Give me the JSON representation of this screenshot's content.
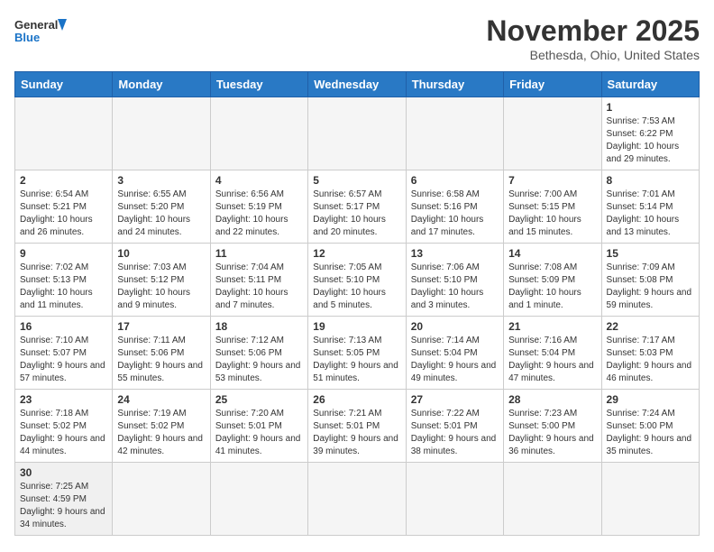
{
  "header": {
    "logo_general": "General",
    "logo_blue": "Blue",
    "month_title": "November 2025",
    "location": "Bethesda, Ohio, United States"
  },
  "weekdays": [
    "Sunday",
    "Monday",
    "Tuesday",
    "Wednesday",
    "Thursday",
    "Friday",
    "Saturday"
  ],
  "weeks": [
    [
      {
        "day": "",
        "info": ""
      },
      {
        "day": "",
        "info": ""
      },
      {
        "day": "",
        "info": ""
      },
      {
        "day": "",
        "info": ""
      },
      {
        "day": "",
        "info": ""
      },
      {
        "day": "",
        "info": ""
      },
      {
        "day": "1",
        "info": "Sunrise: 7:53 AM\nSunset: 6:22 PM\nDaylight: 10 hours and 29 minutes."
      }
    ],
    [
      {
        "day": "2",
        "info": "Sunrise: 6:54 AM\nSunset: 5:21 PM\nDaylight: 10 hours and 26 minutes."
      },
      {
        "day": "3",
        "info": "Sunrise: 6:55 AM\nSunset: 5:20 PM\nDaylight: 10 hours and 24 minutes."
      },
      {
        "day": "4",
        "info": "Sunrise: 6:56 AM\nSunset: 5:19 PM\nDaylight: 10 hours and 22 minutes."
      },
      {
        "day": "5",
        "info": "Sunrise: 6:57 AM\nSunset: 5:17 PM\nDaylight: 10 hours and 20 minutes."
      },
      {
        "day": "6",
        "info": "Sunrise: 6:58 AM\nSunset: 5:16 PM\nDaylight: 10 hours and 17 minutes."
      },
      {
        "day": "7",
        "info": "Sunrise: 7:00 AM\nSunset: 5:15 PM\nDaylight: 10 hours and 15 minutes."
      },
      {
        "day": "8",
        "info": "Sunrise: 7:01 AM\nSunset: 5:14 PM\nDaylight: 10 hours and 13 minutes."
      }
    ],
    [
      {
        "day": "9",
        "info": "Sunrise: 7:02 AM\nSunset: 5:13 PM\nDaylight: 10 hours and 11 minutes."
      },
      {
        "day": "10",
        "info": "Sunrise: 7:03 AM\nSunset: 5:12 PM\nDaylight: 10 hours and 9 minutes."
      },
      {
        "day": "11",
        "info": "Sunrise: 7:04 AM\nSunset: 5:11 PM\nDaylight: 10 hours and 7 minutes."
      },
      {
        "day": "12",
        "info": "Sunrise: 7:05 AM\nSunset: 5:10 PM\nDaylight: 10 hours and 5 minutes."
      },
      {
        "day": "13",
        "info": "Sunrise: 7:06 AM\nSunset: 5:10 PM\nDaylight: 10 hours and 3 minutes."
      },
      {
        "day": "14",
        "info": "Sunrise: 7:08 AM\nSunset: 5:09 PM\nDaylight: 10 hours and 1 minute."
      },
      {
        "day": "15",
        "info": "Sunrise: 7:09 AM\nSunset: 5:08 PM\nDaylight: 9 hours and 59 minutes."
      }
    ],
    [
      {
        "day": "16",
        "info": "Sunrise: 7:10 AM\nSunset: 5:07 PM\nDaylight: 9 hours and 57 minutes."
      },
      {
        "day": "17",
        "info": "Sunrise: 7:11 AM\nSunset: 5:06 PM\nDaylight: 9 hours and 55 minutes."
      },
      {
        "day": "18",
        "info": "Sunrise: 7:12 AM\nSunset: 5:06 PM\nDaylight: 9 hours and 53 minutes."
      },
      {
        "day": "19",
        "info": "Sunrise: 7:13 AM\nSunset: 5:05 PM\nDaylight: 9 hours and 51 minutes."
      },
      {
        "day": "20",
        "info": "Sunrise: 7:14 AM\nSunset: 5:04 PM\nDaylight: 9 hours and 49 minutes."
      },
      {
        "day": "21",
        "info": "Sunrise: 7:16 AM\nSunset: 5:04 PM\nDaylight: 9 hours and 47 minutes."
      },
      {
        "day": "22",
        "info": "Sunrise: 7:17 AM\nSunset: 5:03 PM\nDaylight: 9 hours and 46 minutes."
      }
    ],
    [
      {
        "day": "23",
        "info": "Sunrise: 7:18 AM\nSunset: 5:02 PM\nDaylight: 9 hours and 44 minutes."
      },
      {
        "day": "24",
        "info": "Sunrise: 7:19 AM\nSunset: 5:02 PM\nDaylight: 9 hours and 42 minutes."
      },
      {
        "day": "25",
        "info": "Sunrise: 7:20 AM\nSunset: 5:01 PM\nDaylight: 9 hours and 41 minutes."
      },
      {
        "day": "26",
        "info": "Sunrise: 7:21 AM\nSunset: 5:01 PM\nDaylight: 9 hours and 39 minutes."
      },
      {
        "day": "27",
        "info": "Sunrise: 7:22 AM\nSunset: 5:01 PM\nDaylight: 9 hours and 38 minutes."
      },
      {
        "day": "28",
        "info": "Sunrise: 7:23 AM\nSunset: 5:00 PM\nDaylight: 9 hours and 36 minutes."
      },
      {
        "day": "29",
        "info": "Sunrise: 7:24 AM\nSunset: 5:00 PM\nDaylight: 9 hours and 35 minutes."
      }
    ],
    [
      {
        "day": "30",
        "info": "Sunrise: 7:25 AM\nSunset: 4:59 PM\nDaylight: 9 hours and 34 minutes."
      },
      {
        "day": "",
        "info": ""
      },
      {
        "day": "",
        "info": ""
      },
      {
        "day": "",
        "info": ""
      },
      {
        "day": "",
        "info": ""
      },
      {
        "day": "",
        "info": ""
      },
      {
        "day": "",
        "info": ""
      }
    ]
  ]
}
